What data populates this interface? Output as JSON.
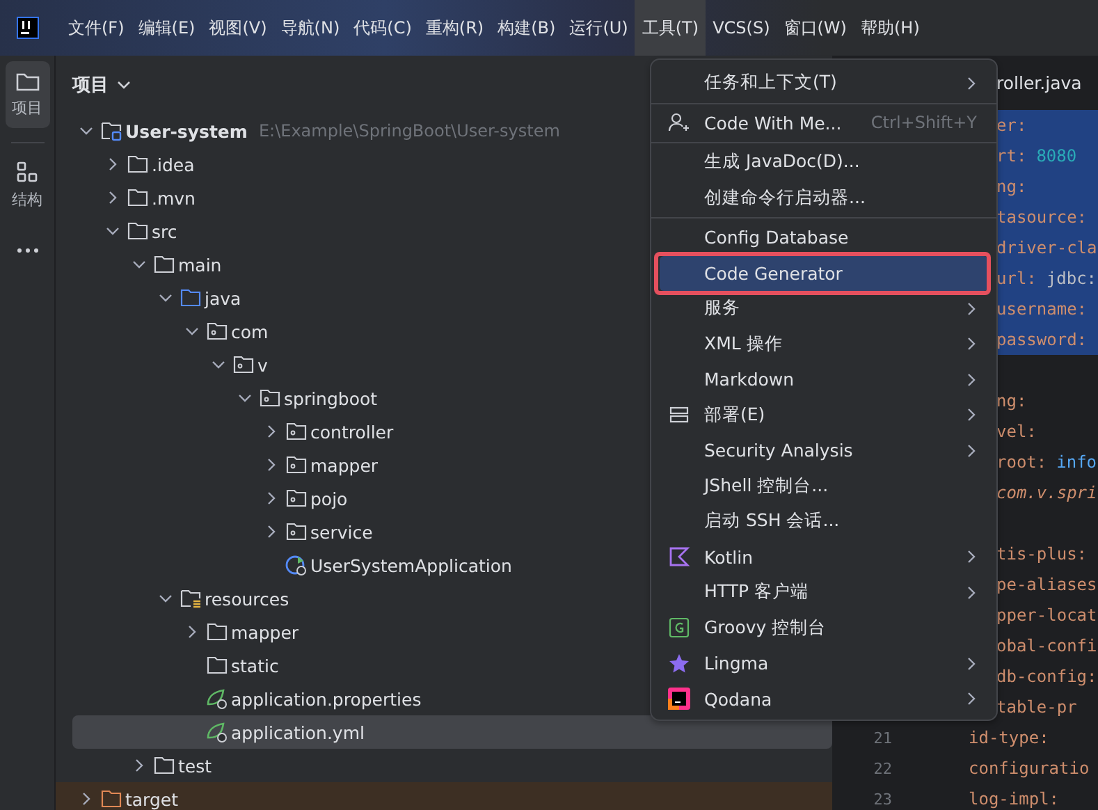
{
  "menubar": {
    "items": [
      {
        "label": "文件(F)",
        "selected": false
      },
      {
        "label": "编辑(E)",
        "selected": false
      },
      {
        "label": "视图(V)",
        "selected": false
      },
      {
        "label": "导航(N)",
        "selected": false
      },
      {
        "label": "代码(C)",
        "selected": false
      },
      {
        "label": "重构(R)",
        "selected": false
      },
      {
        "label": "构建(B)",
        "selected": false
      },
      {
        "label": "运行(U)",
        "selected": false
      },
      {
        "label": "工具(T)",
        "selected": true
      },
      {
        "label": "VCS(S)",
        "selected": false
      },
      {
        "label": "窗口(W)",
        "selected": false
      },
      {
        "label": "帮助(H)",
        "selected": false
      }
    ]
  },
  "toolstrip": {
    "items": [
      {
        "label": "项目",
        "kind": "folder",
        "selected": true
      },
      {
        "label": "结构",
        "kind": "structure",
        "selected": false
      }
    ]
  },
  "project": {
    "title": "项目",
    "tree": [
      {
        "label": "User-system",
        "path": "E:\\Example\\SpringBoot\\User-system",
        "kind": "module",
        "expanded": true,
        "selected": false,
        "children": [
          {
            "label": ".idea",
            "kind": "folder",
            "expanded": false,
            "selected": false
          },
          {
            "label": ".mvn",
            "kind": "folder",
            "expanded": false,
            "selected": false
          },
          {
            "label": "src",
            "kind": "folder",
            "expanded": true,
            "selected": false,
            "children": [
              {
                "label": "main",
                "kind": "folder",
                "expanded": true,
                "selected": false,
                "children": [
                  {
                    "label": "java",
                    "kind": "source",
                    "expanded": true,
                    "selected": false,
                    "children": [
                      {
                        "label": "com",
                        "kind": "package",
                        "expanded": true,
                        "selected": false,
                        "children": [
                          {
                            "label": "v",
                            "kind": "package",
                            "expanded": true,
                            "selected": false,
                            "children": [
                              {
                                "label": "springboot",
                                "kind": "package",
                                "expanded": true,
                                "selected": false,
                                "children": [
                                  {
                                    "label": "controller",
                                    "kind": "package",
                                    "expanded": false,
                                    "selected": false
                                  },
                                  {
                                    "label": "mapper",
                                    "kind": "package",
                                    "expanded": false,
                                    "selected": false
                                  },
                                  {
                                    "label": "pojo",
                                    "kind": "package",
                                    "expanded": false,
                                    "selected": false
                                  },
                                  {
                                    "label": "service",
                                    "kind": "package",
                                    "expanded": false,
                                    "selected": false
                                  },
                                  {
                                    "label": "UserSystemApplication",
                                    "kind": "class",
                                    "selected": false
                                  }
                                ]
                              }
                            ]
                          }
                        ]
                      }
                    ]
                  },
                  {
                    "label": "resources",
                    "kind": "resources",
                    "expanded": true,
                    "selected": false,
                    "children": [
                      {
                        "label": "mapper",
                        "kind": "folder",
                        "expanded": false,
                        "selected": false
                      },
                      {
                        "label": "static",
                        "kind": "folder",
                        "selected": false
                      },
                      {
                        "label": "application.properties",
                        "kind": "spring",
                        "selected": false
                      },
                      {
                        "label": "application.yml",
                        "kind": "spring",
                        "selected": true
                      }
                    ]
                  }
                ]
              },
              {
                "label": "test",
                "kind": "folder",
                "expanded": false,
                "selected": false
              }
            ]
          },
          {
            "label": "target",
            "kind": "excluded",
            "expanded": false,
            "selected": false
          }
        ]
      }
    ]
  },
  "editor": {
    "tab": "roller.java",
    "partial_lines": [
      {
        "selected": true,
        "tokens": [
          {
            "text": "er:",
            "kind": "key"
          }
        ]
      },
      {
        "selected": true,
        "tokens": [
          {
            "text": "rt:",
            "kind": "key"
          },
          {
            "text": "8080",
            "kind": "number"
          }
        ]
      },
      {
        "selected": true,
        "tokens": [
          {
            "text": "ng:",
            "kind": "key"
          }
        ]
      },
      {
        "selected": true,
        "tokens": [
          {
            "text": "tasource:",
            "kind": "key"
          }
        ]
      },
      {
        "selected": true,
        "tokens": [
          {
            "text": "driver-cla",
            "kind": "key"
          }
        ]
      },
      {
        "selected": true,
        "tokens": [
          {
            "text": "url:",
            "kind": "key"
          },
          {
            "text": "jdbc:",
            "kind": "plain"
          }
        ]
      },
      {
        "selected": true,
        "tokens": [
          {
            "text": "username:",
            "kind": "key"
          }
        ]
      },
      {
        "selected": true,
        "tokens": [
          {
            "text": "password:",
            "kind": "key"
          }
        ]
      },
      {
        "selected": false
      },
      {
        "selected": false,
        "tokens": [
          {
            "text": "ng:",
            "kind": "key"
          }
        ]
      },
      {
        "selected": false,
        "tokens": [
          {
            "text": "vel:",
            "kind": "key"
          }
        ]
      },
      {
        "selected": false,
        "tokens": [
          {
            "text": "root:",
            "kind": "key"
          },
          {
            "text": "info",
            "kind": "enum"
          }
        ]
      },
      {
        "selected": false,
        "tokens": [
          {
            "text": "com.v.spri",
            "kind": "italic"
          }
        ]
      },
      {
        "selected": false
      },
      {
        "selected": false,
        "tokens": [
          {
            "text": "tis-plus:",
            "kind": "key"
          }
        ]
      },
      {
        "selected": false,
        "tokens": [
          {
            "text": "pe-aliases",
            "kind": "key"
          }
        ]
      },
      {
        "selected": false,
        "tokens": [
          {
            "text": "pper-locat",
            "kind": "key"
          }
        ]
      },
      {
        "selected": false,
        "tokens": [
          {
            "text": "obal-confi",
            "kind": "key"
          }
        ]
      },
      {
        "selected": false,
        "tokens": [
          {
            "text": "db-config:",
            "kind": "key"
          }
        ]
      },
      {
        "selected": false,
        "tokens": [
          {
            "text": "table-pr",
            "kind": "key"
          }
        ]
      }
    ],
    "lines": [
      {
        "number": "21",
        "tokens": [
          {
            "text": "id-type:",
            "kind": "key"
          }
        ]
      },
      {
        "number": "22",
        "tokens": [
          {
            "text": "configuratio",
            "kind": "key"
          }
        ]
      },
      {
        "number": "23",
        "tokens": [
          {
            "text": "log-impl:",
            "kind": "key"
          }
        ]
      }
    ]
  },
  "menu": {
    "groups": [
      [
        {
          "label": "任务和上下文(T)",
          "kind": "plain",
          "submenu": true,
          "selected": false,
          "outlined": false
        }
      ],
      [
        {
          "label": "Code With Me...",
          "kind": "collab",
          "shortcut": "Ctrl+Shift+Y",
          "submenu": false,
          "selected": false,
          "outlined": false
        }
      ],
      [
        {
          "label": "生成 JavaDoc(D)...",
          "kind": "plain",
          "submenu": false,
          "selected": false,
          "outlined": false
        },
        {
          "label": "创建命令行启动器...",
          "kind": "plain",
          "submenu": false,
          "selected": false,
          "outlined": false
        }
      ],
      [
        {
          "label": "Config Database",
          "kind": "plain",
          "submenu": false,
          "selected": false,
          "outlined": false
        },
        {
          "label": "Code Generator",
          "kind": "plain",
          "submenu": false,
          "selected": true,
          "outlined": true
        },
        {
          "label": "服务",
          "kind": "plain",
          "submenu": true,
          "selected": false,
          "outlined": false
        },
        {
          "label": "XML 操作",
          "kind": "plain",
          "submenu": true,
          "selected": false,
          "outlined": false
        },
        {
          "label": "Markdown",
          "kind": "plain",
          "submenu": true,
          "selected": false,
          "outlined": false
        },
        {
          "label": "部署(E)",
          "kind": "deploy",
          "submenu": true,
          "selected": false,
          "outlined": false
        },
        {
          "label": "Security Analysis",
          "kind": "plain",
          "submenu": true,
          "selected": false,
          "outlined": false
        },
        {
          "label": "JShell 控制台...",
          "kind": "plain",
          "submenu": false,
          "selected": false,
          "outlined": false
        },
        {
          "label": "启动 SSH 会话...",
          "kind": "plain",
          "submenu": false,
          "selected": false,
          "outlined": false
        },
        {
          "label": "Kotlin",
          "kind": "kotlin",
          "submenu": true,
          "selected": false,
          "outlined": false
        },
        {
          "label": "HTTP 客户端",
          "kind": "plain",
          "submenu": true,
          "selected": false,
          "outlined": false
        },
        {
          "label": "Groovy 控制台",
          "kind": "groovy",
          "submenu": false,
          "selected": false,
          "outlined": false
        },
        {
          "label": "Lingma",
          "kind": "lingma",
          "submenu": true,
          "selected": false,
          "outlined": false
        },
        {
          "label": "Qodana",
          "kind": "qodana",
          "submenu": true,
          "selected": false,
          "outlined": false
        }
      ]
    ]
  }
}
